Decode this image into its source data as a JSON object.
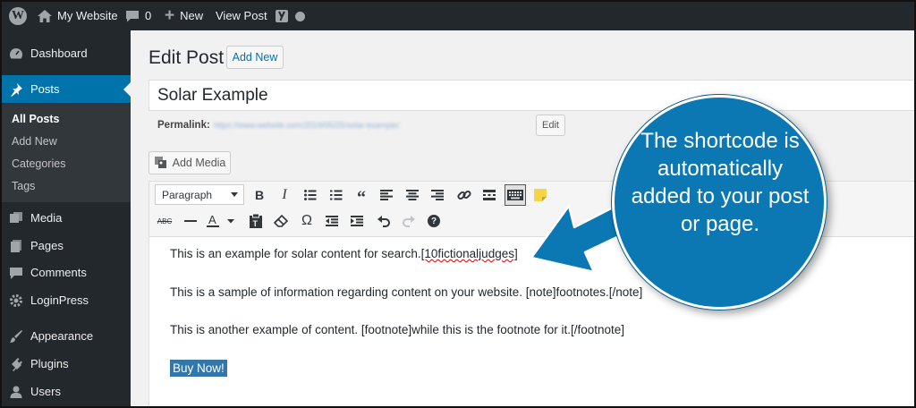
{
  "admin_bar": {
    "site_name": "My Website",
    "comments_count": "0",
    "new_label": "New",
    "view_post_label": "View Post"
  },
  "sidebar": {
    "items": [
      {
        "label": "Dashboard",
        "icon": "dashboard-icon"
      },
      {
        "label": "Posts",
        "icon": "pin-icon"
      },
      {
        "label": "Media",
        "icon": "media-icon"
      },
      {
        "label": "Pages",
        "icon": "pages-icon"
      },
      {
        "label": "Comments",
        "icon": "comment-icon"
      },
      {
        "label": "LoginPress",
        "icon": "gear-icon"
      },
      {
        "label": "Appearance",
        "icon": "brush-icon"
      },
      {
        "label": "Plugins",
        "icon": "plug-icon"
      },
      {
        "label": "Users",
        "icon": "user-icon"
      }
    ],
    "submenu": [
      "All Posts",
      "Add New",
      "Categories",
      "Tags"
    ]
  },
  "page": {
    "title": "Edit Post",
    "add_new_label": "Add New",
    "post_title": "Solar Example",
    "permalink_label": "Permalink:",
    "permalink_url": "https://www.website.com/2019/05/25/solar-example/",
    "edit_label": "Edit",
    "add_media_label": "Add Media"
  },
  "editor": {
    "format_select": "Paragraph",
    "paragraphs": {
      "p1_text": "This is an example for solar content for search.",
      "p1_shortcode": "[10fictionaljudges]",
      "p2": "This is a sample of information regarding content on your website. [note]footnotes.[/note]",
      "p3": "This is another example of content. [footnote]while this is the footnote for it.[/footnote]"
    },
    "button_text": "Buy Now!"
  },
  "callout": {
    "text": "The shortcode is automatically added to your post or page."
  },
  "colors": {
    "admin_bar": "#23282d",
    "active_menu": "#0073aa",
    "callout": "#0b78b3"
  }
}
